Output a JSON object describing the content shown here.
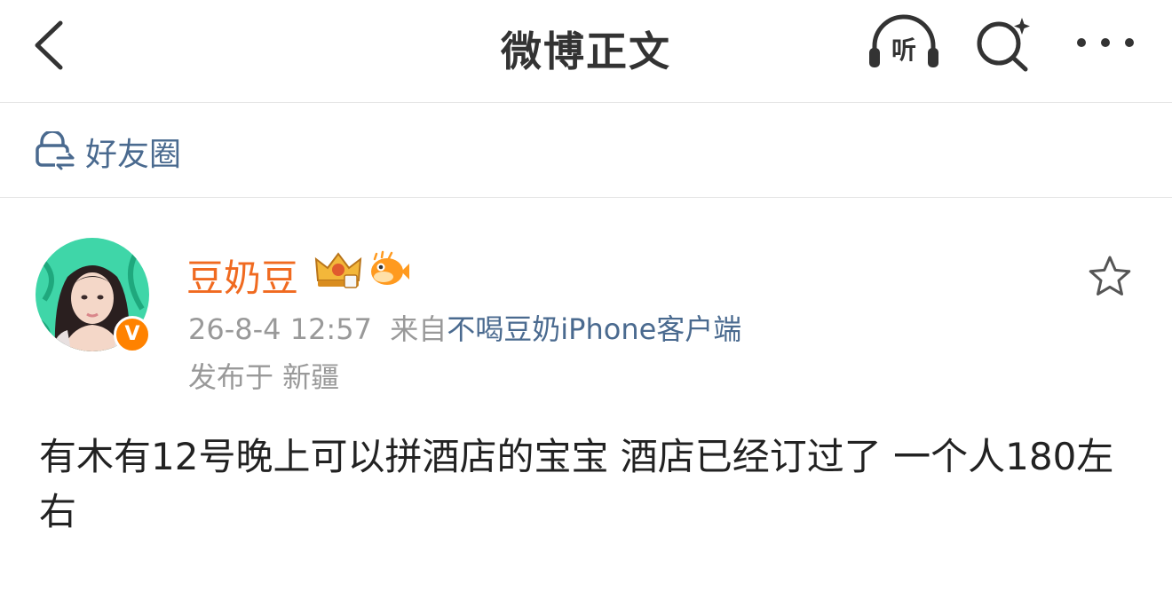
{
  "navbar": {
    "title": "微博正文",
    "listen_label": "听",
    "icons": [
      "back-icon",
      "listen-icon",
      "search-icon",
      "more-icon"
    ]
  },
  "visibility": {
    "label": "好友圈",
    "icon": "friend-circle-icon"
  },
  "post": {
    "username": "豆奶豆",
    "verified_mark": "V",
    "time": "26-8-4 12:57",
    "from_prefix": "来自",
    "source": "不喝豆奶iPhone客户端",
    "location": "发布于 新疆",
    "text": "有木有12号晚上可以拼酒店的宝宝 酒店已经订过了 一个人180左右"
  },
  "colors": {
    "username": "#f06a20",
    "link": "#4a6a8f",
    "meta": "#999999",
    "verified": "#ff8200"
  }
}
